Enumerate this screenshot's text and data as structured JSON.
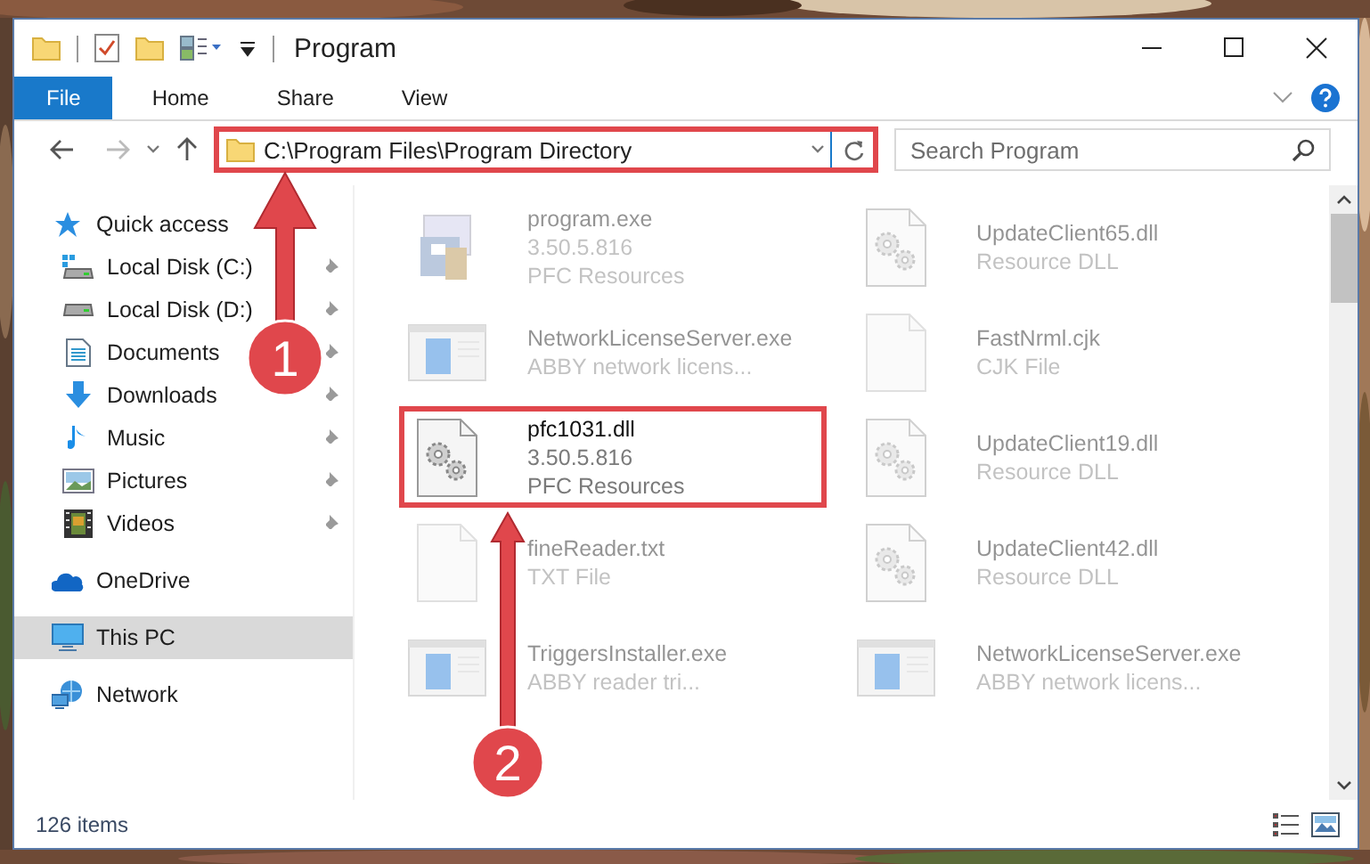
{
  "window": {
    "title": "Program"
  },
  "ribbon": {
    "tabs": [
      {
        "label": "File",
        "selected": true
      },
      {
        "label": "Home",
        "selected": false
      },
      {
        "label": "Share",
        "selected": false
      },
      {
        "label": "View",
        "selected": false
      }
    ]
  },
  "address": {
    "path": "C:\\Program Files\\Program Directory",
    "highlighted": true
  },
  "search": {
    "placeholder": "Search Program"
  },
  "sidebar": {
    "items": [
      {
        "label": "Quick access",
        "kind": "star",
        "selected": false,
        "children": [
          {
            "label": "Local Disk (C:)",
            "kind": "system-disk",
            "selected": false,
            "pinned": true
          },
          {
            "label": "Local Disk (D:)",
            "kind": "disk",
            "selected": false,
            "pinned": true
          },
          {
            "label": "Documents",
            "kind": "documents",
            "selected": false,
            "pinned": true
          },
          {
            "label": "Downloads",
            "kind": "downloads",
            "selected": false,
            "pinned": true
          },
          {
            "label": "Music",
            "kind": "music",
            "selected": false,
            "pinned": true
          },
          {
            "label": "Pictures",
            "kind": "pictures",
            "selected": false,
            "pinned": true
          },
          {
            "label": "Videos",
            "kind": "videos",
            "selected": false,
            "pinned": true
          }
        ]
      },
      {
        "label": "OneDrive",
        "kind": "cloud",
        "selected": false
      },
      {
        "label": "This PC",
        "kind": "pc",
        "selected": true
      },
      {
        "label": "Network",
        "kind": "network",
        "selected": false
      }
    ]
  },
  "files": [
    {
      "name": "program.exe",
      "details": [
        "3.50.5.816",
        "PFC Resources"
      ],
      "kind": "app",
      "blurred": true,
      "highlighted": false
    },
    {
      "name": "NetworkLicenseServer.exe",
      "details": [
        "ABBY network licens..."
      ],
      "kind": "window",
      "blurred": true,
      "highlighted": false
    },
    {
      "name": "pfc1031.dll",
      "details": [
        "3.50.5.816",
        "PFC Resources"
      ],
      "kind": "dll",
      "blurred": false,
      "highlighted": true
    },
    {
      "name": "fineReader.txt",
      "details": [
        "TXT File"
      ],
      "kind": "doc",
      "blurred": true,
      "highlighted": false
    },
    {
      "name": "TriggersInstaller.exe",
      "details": [
        "ABBY reader tri..."
      ],
      "kind": "window",
      "blurred": true,
      "highlighted": false
    },
    {
      "name": "UpdateClient65.dll",
      "details": [
        "Resource DLL"
      ],
      "kind": "dll",
      "blurred": true,
      "highlighted": false
    },
    {
      "name": "FastNrml.cjk",
      "details": [
        "CJK File"
      ],
      "kind": "doc",
      "blurred": true,
      "highlighted": false
    },
    {
      "name": "UpdateClient19.dll",
      "details": [
        "Resource DLL"
      ],
      "kind": "dll",
      "blurred": true,
      "highlighted": false
    },
    {
      "name": "UpdateClient42.dll",
      "details": [
        "Resource DLL"
      ],
      "kind": "dll",
      "blurred": true,
      "highlighted": false
    },
    {
      "name": "NetworkLicenseServer.exe",
      "details": [
        "ABBY network licens..."
      ],
      "kind": "window",
      "blurred": true,
      "highlighted": false
    }
  ],
  "status_bar": {
    "text": "126 items"
  },
  "annotations": [
    {
      "label": "1"
    },
    {
      "label": "2"
    }
  ]
}
